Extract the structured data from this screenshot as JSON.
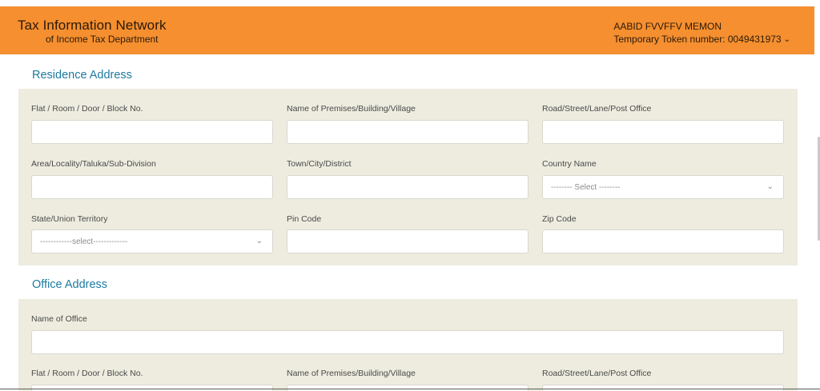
{
  "header": {
    "title": "Tax Information Network",
    "subtitle": "of Income Tax Department",
    "user_name": "AABID FVVFFV MEMON",
    "token_label": "Temporary Token number: 0049431973",
    "chevron": "chevron-down-icon",
    "bg_color": "#f58f2f"
  },
  "residence": {
    "title": "Residence Address",
    "fields": {
      "flat": "Flat / Room / Door / Block No.",
      "premises": "Name of Premises/Building/Village",
      "road": "Road/Street/Lane/Post Office",
      "area": "Area/Locality/Taluka/Sub-Division",
      "town": "Town/City/District",
      "country": "Country Name",
      "country_value": "-------- Select --------",
      "state": "State/Union Territory",
      "state_value": "------------select-------------",
      "pin": "Pin Code",
      "zip": "Zip Code"
    }
  },
  "office": {
    "title": "Office Address",
    "fields": {
      "name": "Name of Office",
      "flat": "Flat / Room / Door / Block No.",
      "premises": "Name of Premises/Building/Village",
      "road": "Road/Street/Lane/Post Office"
    }
  },
  "colors": {
    "accent": "#1d7aa1",
    "panel_bg": "#edecdf"
  }
}
